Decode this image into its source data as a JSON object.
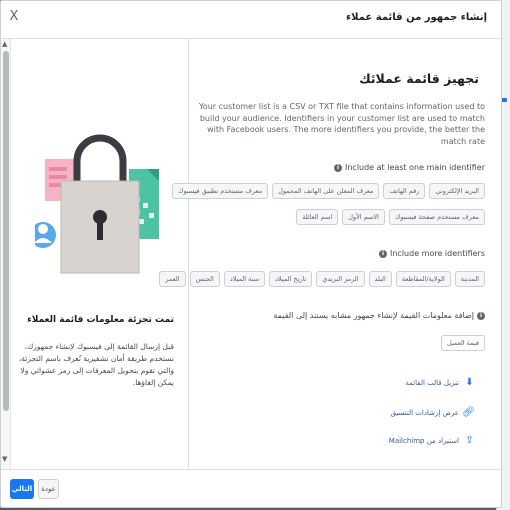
{
  "header": {
    "title": "إنشاء جمهور من قائمة عملاء",
    "close_glyph": "X"
  },
  "left": {
    "heading": "تمت تجزئة معلومات قائمة العملاء",
    "description": "قبل إرسال القائمة إلى فيسبوك لإنشاء جمهورك، نستخدم طريقة أمان تشفيرية تُعرف باسم التجزئة، والتي تقوم بتحويل المعرفات إلى رمز عشوائي ولا يمكن إلغاؤها."
  },
  "right": {
    "heading": "تجهيز قائمة عملائك",
    "description": "Your customer list is a CSV or TXT file that contains information used to build your audience. Identifiers in your customer list are used to match with Facebook users. The more identifiers you provide, the better the match rate",
    "main_section_label": "Include at least one main identifier",
    "main_identifiers_row1": [
      "البريد الإلكتروني",
      "رقم الهاتف",
      "معرف المعلن على الهاتف المحمول",
      "معرف مستخدم تطبيق فيسبوك"
    ],
    "main_identifiers_row2": [
      "معرف مستخدم صفحة فيسبوك",
      "الاسم الأول",
      "اسم العائلة"
    ],
    "more_section_label": "Include more identifiers",
    "more_identifiers": [
      "المدينة",
      "الولاية/المقاطعة",
      "البلد",
      "الرمز البريدي",
      "تاريخ الميلاد",
      "سنة الميلاد",
      "الجنس",
      "العمر"
    ],
    "value_section_label": "إضافة معلومات القيمة لإنشاء جمهور مشابه يستند إلى القيمة",
    "value_chip": "قيمة العميل",
    "links": [
      {
        "label": "تنزيل قالب القائمة",
        "icon": "download-icon"
      },
      {
        "label": "عرض إرشادات التنسيق",
        "icon": "link-icon"
      },
      {
        "label": "استيراد من Mailchimp",
        "icon": "import-icon"
      }
    ]
  },
  "footer": {
    "next_label": "التالي",
    "back_label": "عودة"
  },
  "colors": {
    "accent": "#1877f2",
    "link": "#385898"
  }
}
